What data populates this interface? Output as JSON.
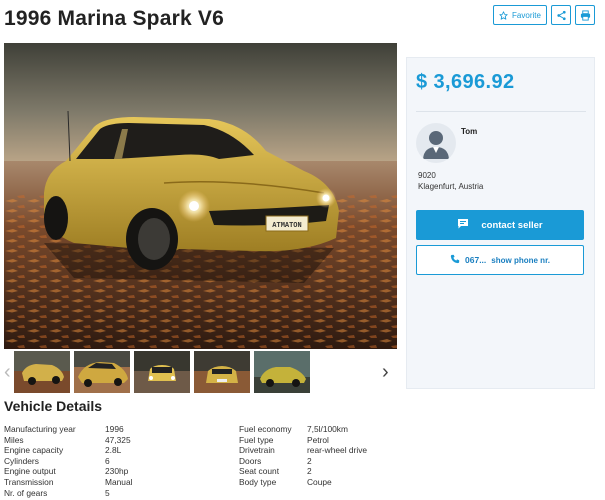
{
  "listing": {
    "title": "1996 Marina Spark V6"
  },
  "actions": {
    "favorite_label": "Favorite"
  },
  "photo": {
    "plate_text": "ATMATON"
  },
  "gallery": {
    "thumb_count": 5,
    "current_index": 0
  },
  "details": {
    "section_title": "Vehicle Details",
    "left": [
      {
        "label": "Manufacturing year",
        "value": "1996"
      },
      {
        "label": "Miles",
        "value": "47,325"
      },
      {
        "label": "Engine capacity",
        "value": "2.8L"
      },
      {
        "label": "Cylinders",
        "value": "6"
      },
      {
        "label": "Engine output",
        "value": "230hp"
      },
      {
        "label": "Transmission",
        "value": "Manual"
      },
      {
        "label": "Nr. of gears",
        "value": "5"
      }
    ],
    "right": [
      {
        "label": "Fuel economy",
        "value": "7,5l/100km"
      },
      {
        "label": "Fuel type",
        "value": "Petrol"
      },
      {
        "label": "Drivetrain",
        "value": "rear-wheel drive"
      },
      {
        "label": "Doors",
        "value": "2"
      },
      {
        "label": "Seat count",
        "value": "2"
      },
      {
        "label": "Body type",
        "value": "Coupe"
      }
    ]
  },
  "seller": {
    "price": "$ 3,696.92",
    "name": "Tom",
    "postcode": "9020",
    "city": "Klagenfurt, Austria",
    "contact_label": "contact seller",
    "phone_partial": "067...",
    "show_phone_label": "show phone nr."
  },
  "colors": {
    "accent": "#1a9ad6",
    "car": "#c9a53a"
  }
}
